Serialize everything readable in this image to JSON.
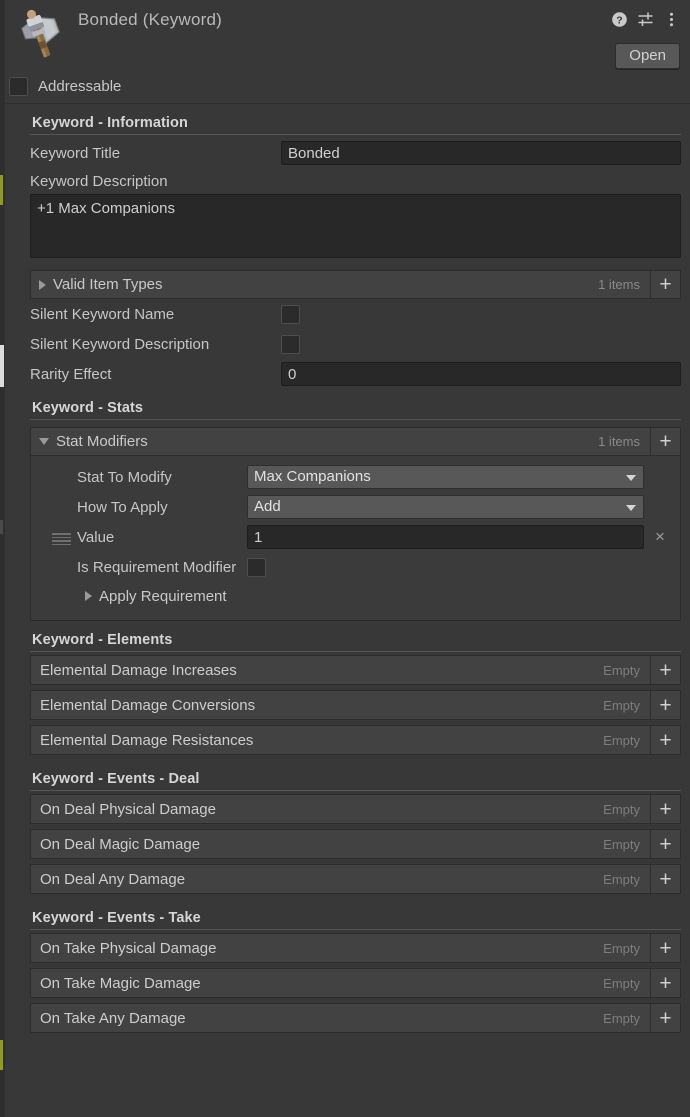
{
  "header": {
    "title": "Bonded (Keyword)",
    "icon": "axe-asset-icon",
    "help_icon": "help-icon",
    "preset_icon": "preset-sliders-icon",
    "menu_icon": "kebab-menu-icon",
    "open_label": "Open"
  },
  "addressable": {
    "label": "Addressable",
    "checked": false
  },
  "sections": {
    "information": {
      "title": "Keyword - Information",
      "keyword_title_label": "Keyword Title",
      "keyword_title_value": "Bonded",
      "keyword_description_label": "Keyword Description",
      "keyword_description_value": "+1 Max Companions",
      "valid_item_types": {
        "label": "Valid Item Types",
        "count": "1 items",
        "expanded": false,
        "add_label": "+"
      },
      "silent_keyword_name_label": "Silent Keyword Name",
      "silent_keyword_name_checked": false,
      "silent_keyword_description_label": "Silent Keyword Description",
      "silent_keyword_description_checked": false,
      "rarity_effect_label": "Rarity Effect",
      "rarity_effect_value": "0"
    },
    "stats": {
      "title": "Keyword - Stats",
      "stat_modifiers": {
        "label": "Stat Modifiers",
        "count": "1 items",
        "expanded": true,
        "add_label": "+"
      },
      "modifier": {
        "stat_to_modify_label": "Stat To Modify",
        "stat_to_modify_value": "Max Companions",
        "how_to_apply_label": "How To Apply",
        "how_to_apply_value": "Add",
        "value_label": "Value",
        "value_value": "1",
        "remove_label": "×",
        "is_requirement_modifier_label": "Is Requirement Modifier",
        "is_requirement_modifier_checked": false,
        "apply_requirement_label": "Apply Requirement",
        "apply_requirement_expanded": false
      }
    },
    "elements": {
      "title": "Keyword - Elements",
      "rows": [
        {
          "label": "Elemental Damage Increases",
          "status": "Empty",
          "add_label": "+"
        },
        {
          "label": "Elemental Damage Conversions",
          "status": "Empty",
          "add_label": "+"
        },
        {
          "label": "Elemental Damage Resistances",
          "status": "Empty",
          "add_label": "+"
        }
      ]
    },
    "events_deal": {
      "title": "Keyword - Events - Deal",
      "rows": [
        {
          "label": "On Deal Physical Damage",
          "status": "Empty",
          "add_label": "+"
        },
        {
          "label": "On Deal Magic Damage",
          "status": "Empty",
          "add_label": "+"
        },
        {
          "label": "On Deal Any Damage",
          "status": "Empty",
          "add_label": "+"
        }
      ]
    },
    "events_take": {
      "title": "Keyword - Events - Take",
      "rows": [
        {
          "label": "On Take Physical Damage",
          "status": "Empty",
          "add_label": "+"
        },
        {
          "label": "On Take Magic Damage",
          "status": "Empty",
          "add_label": "+"
        },
        {
          "label": "On Take Any Damage",
          "status": "Empty",
          "add_label": "+"
        }
      ]
    }
  },
  "colors": {
    "background": "#383838",
    "row_background": "#424242",
    "field_background": "#282828",
    "dropdown_background": "#585858",
    "text": "#c6c6c6",
    "muted_text": "#7e7e7e"
  }
}
